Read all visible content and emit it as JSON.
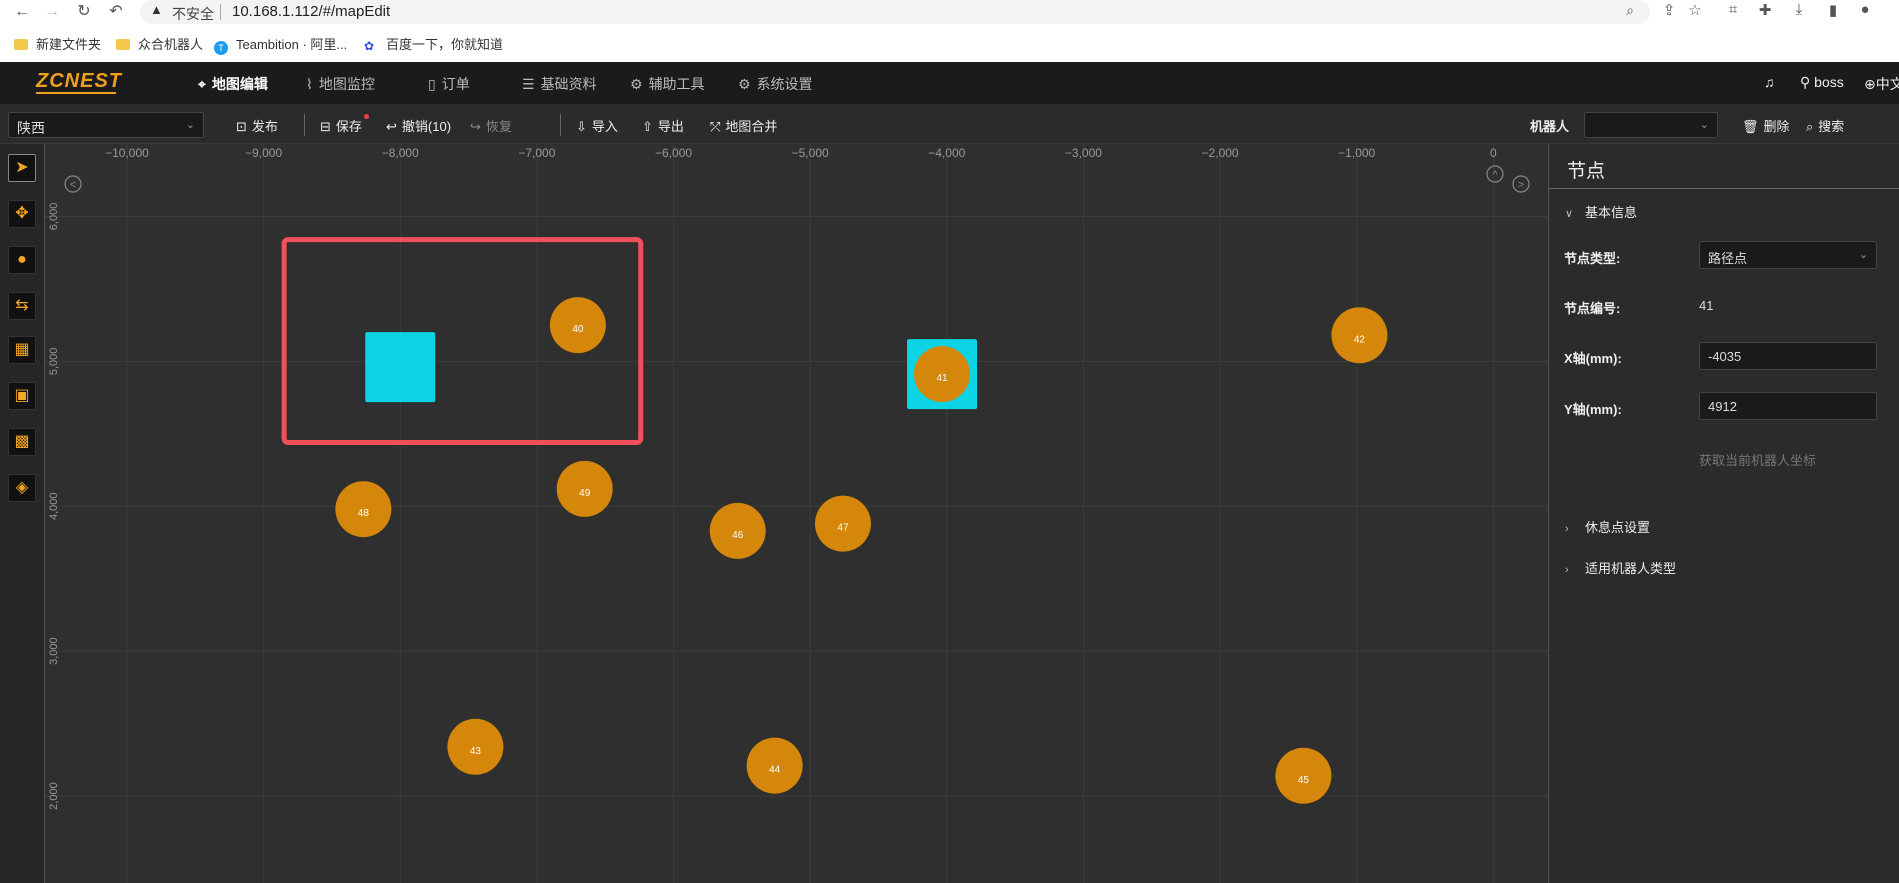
{
  "browser": {
    "insecure_label": "不安全",
    "url": "10.168.1.112/#/mapEdit",
    "bookmarks": [
      "新建文件夹",
      "众合机器人",
      "Teambition · 阿里...",
      "百度一下，你就知道"
    ]
  },
  "app": {
    "logo": "ZCNEST",
    "menu": [
      {
        "label": "地图编辑",
        "icon": "location-pin-icon",
        "active": true
      },
      {
        "label": "地图监控",
        "icon": "line-chart-icon",
        "active": false
      },
      {
        "label": "订单",
        "icon": "document-icon",
        "active": false
      },
      {
        "label": "基础资料",
        "icon": "sliders-icon",
        "active": false
      },
      {
        "label": "辅助工具",
        "icon": "gear-icon",
        "active": false
      },
      {
        "label": "系统设置",
        "icon": "gear-icon",
        "active": false
      }
    ],
    "user": "boss",
    "language": "中文"
  },
  "toolbar": {
    "map_select_value": "陕西",
    "publish": "发布",
    "save": "保存",
    "undo": "撤销(10)",
    "redo": "恢复",
    "import": "导入",
    "export": "导出",
    "merge": "地图合并",
    "robot_label": "机器人",
    "robot_value": "",
    "delete": "删除",
    "search": "搜索"
  },
  "tools": [
    {
      "name": "select-tool",
      "icon": "pointer-icon"
    },
    {
      "name": "move-tool",
      "icon": "move-arrows-icon"
    },
    {
      "name": "node-tool",
      "icon": "circle-node-icon"
    },
    {
      "name": "path-tool",
      "icon": "path-icon"
    },
    {
      "name": "shelf-tool",
      "icon": "shelf-icon"
    },
    {
      "name": "station-tool",
      "icon": "station-icon"
    },
    {
      "name": "qr-tool",
      "icon": "qr-code-icon"
    },
    {
      "name": "area-tool",
      "icon": "area-icon"
    }
  ],
  "map": {
    "x_ticks": [
      "−10,000",
      "−9,000",
      "−8,000",
      "−7,000",
      "−6,000",
      "−5,000",
      "−4,000",
      "−3,000",
      "−2,000",
      "−1,000",
      "0"
    ],
    "y_ticks": [
      "6,000",
      "5,000",
      "4,000",
      "3,000",
      "2,000"
    ],
    "x_range": [
      -10600,
      400
    ],
    "y_range": [
      1400,
      6500
    ],
    "nodes": [
      {
        "id": "40",
        "x": -6700,
        "y": 5250
      },
      {
        "id": "41",
        "x": -4035,
        "y": 4912
      },
      {
        "id": "42",
        "x": -980,
        "y": 5180
      },
      {
        "id": "43",
        "x": -7450,
        "y": 2340
      },
      {
        "id": "44",
        "x": -5260,
        "y": 2210
      },
      {
        "id": "45",
        "x": -1390,
        "y": 2140
      },
      {
        "id": "46",
        "x": -5530,
        "y": 3830
      },
      {
        "id": "47",
        "x": -4760,
        "y": 3880
      },
      {
        "id": "48",
        "x": -8270,
        "y": 3980
      },
      {
        "id": "49",
        "x": -6650,
        "y": 4120
      }
    ],
    "stations": [
      {
        "x": -8000,
        "y": 4960,
        "label": ""
      },
      {
        "x": -4035,
        "y": 4912,
        "label": ""
      }
    ],
    "selection_box": {
      "x1": -8850,
      "y1": 5840,
      "x2": -6240,
      "y2": 4440
    },
    "node_color": "#d4870a",
    "station_color": "#0cd4e4",
    "selection_color": "#f0505a"
  },
  "panel": {
    "title": "节点",
    "basic_info": "基本信息",
    "node_type_label": "节点类型:",
    "node_type_value": "路径点",
    "node_id_label": "节点编号:",
    "node_id_value": "41",
    "x_label": "X轴(mm):",
    "x_value": "-4035",
    "y_label": "Y轴(mm):",
    "y_value": "4912",
    "get_coord": "获取当前机器人坐标",
    "rest_point": "休息点设置",
    "robot_types": "适用机器人类型"
  }
}
